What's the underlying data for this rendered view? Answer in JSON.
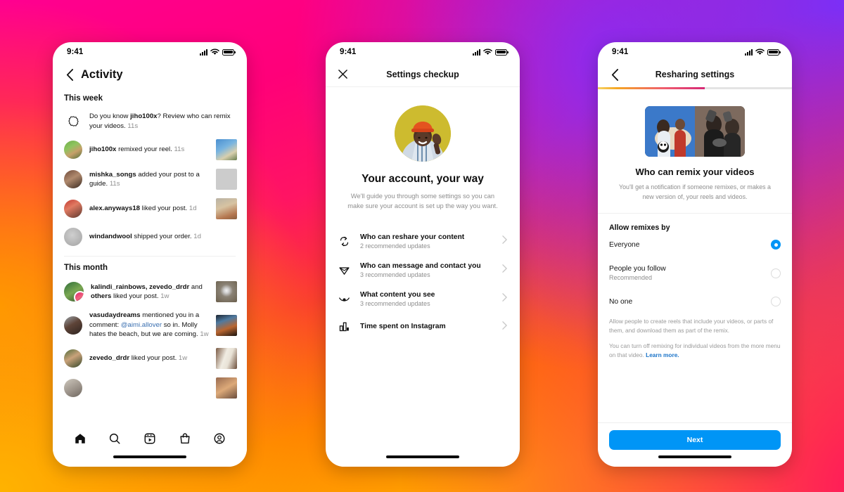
{
  "background": {
    "gradient_colors": [
      "#ff0090",
      "#ff0079",
      "#fb3a2f",
      "#ff7a00",
      "#ffb800",
      "#7b2ff7",
      "#9b27e8",
      "#ff1060"
    ]
  },
  "phone1": {
    "status": {
      "time": "9:41",
      "signal_icon": "cellular-bars-icon",
      "wifi_icon": "wifi-icon",
      "battery_icon": "battery-full-icon"
    },
    "header": {
      "back_icon": "chevron-left-icon",
      "title": "Activity"
    },
    "sections": [
      {
        "label": "This week",
        "items": [
          {
            "type": "prompt",
            "icon": "remix-burst-icon",
            "parts": [
              {
                "t": "Do you know ",
                "style": "normal"
              },
              {
                "t": "jiho100x",
                "style": "bold"
              },
              {
                "t": "? Review who can remix your videos. ",
                "style": "normal"
              },
              {
                "t": "11s",
                "style": "time"
              }
            ],
            "has_thumb": false
          },
          {
            "type": "activity",
            "avatar": "avatar-jiho100x",
            "parts": [
              {
                "t": "jiho100x",
                "style": "bold"
              },
              {
                "t": " remixed your reel. ",
                "style": "normal"
              },
              {
                "t": "11s",
                "style": "time"
              }
            ],
            "has_thumb": true,
            "thumb": "thumb-blue-sky-building"
          },
          {
            "type": "activity",
            "avatar": "avatar-mishka-songs",
            "parts": [
              {
                "t": "mishka_songs",
                "style": "bold"
              },
              {
                "t": " added your post to a guide. ",
                "style": "normal"
              },
              {
                "t": "11s",
                "style": "time"
              }
            ],
            "has_thumb": true,
            "thumb": "thumb-desert-person"
          },
          {
            "type": "activity",
            "avatar": "avatar-alex-anyways18",
            "parts": [
              {
                "t": "alex.anyways18",
                "style": "bold"
              },
              {
                "t": " liked your post. ",
                "style": "normal"
              },
              {
                "t": "1d",
                "style": "time"
              }
            ],
            "has_thumb": true,
            "thumb": "thumb-group-outdoors"
          },
          {
            "type": "activity",
            "avatar": "avatar-windandwool",
            "parts": [
              {
                "t": "windandwool",
                "style": "bold"
              },
              {
                "t": " shipped your order. ",
                "style": "normal"
              },
              {
                "t": "1d",
                "style": "time"
              }
            ],
            "has_thumb": false
          }
        ]
      },
      {
        "label": "This month",
        "items": [
          {
            "type": "activity",
            "avatar": "avatar-kalindi-rainbows-group",
            "parts": [
              {
                "t": "kalindi_rainbows, zevedo_drdr",
                "style": "bold"
              },
              {
                "t": " and ",
                "style": "normal"
              },
              {
                "t": "others",
                "style": "bold"
              },
              {
                "t": " liked your post. ",
                "style": "normal"
              },
              {
                "t": "1w",
                "style": "time"
              }
            ],
            "has_thumb": true,
            "thumb": "thumb-vinyl-record"
          },
          {
            "type": "activity",
            "avatar": "avatar-vasudaydreams",
            "parts": [
              {
                "t": "vasudaydreams",
                "style": "bold"
              },
              {
                "t": " mentioned you in a comment: ",
                "style": "normal"
              },
              {
                "t": "@aimi.allover",
                "style": "mention"
              },
              {
                "t": " so in. Molly hates the beach, but we are coming. ",
                "style": "normal"
              },
              {
                "t": "1w",
                "style": "time"
              }
            ],
            "has_thumb": true,
            "thumb": "thumb-dark-interior"
          },
          {
            "type": "activity",
            "avatar": "avatar-zevedo-drdr",
            "parts": [
              {
                "t": "zevedo_drdr",
                "style": "bold"
              },
              {
                "t": " liked your post. ",
                "style": "normal"
              },
              {
                "t": "1w",
                "style": "time"
              }
            ],
            "has_thumb": true,
            "thumb": "thumb-light-doorway"
          }
        ]
      }
    ],
    "tabbar": [
      {
        "name": "home-icon",
        "label": "Home"
      },
      {
        "name": "search-icon",
        "label": "Search"
      },
      {
        "name": "reels-icon",
        "label": "Reels"
      },
      {
        "name": "shop-icon",
        "label": "Shop"
      },
      {
        "name": "profile-icon",
        "label": "Profile"
      }
    ]
  },
  "phone2": {
    "status": {
      "time": "9:41"
    },
    "header": {
      "close_icon": "close-x-icon",
      "title": "Settings checkup"
    },
    "hero": {
      "image_name": "person-waving-orange-hat-photo"
    },
    "heading": "Your account, your way",
    "subheading": "We'll guide you through some settings so you can make sure your account is set up the way you want.",
    "menu": [
      {
        "icon": "reshare-loop-icon",
        "title": "Who can reshare your content",
        "subtitle": "2 recommended updates",
        "chevron": "chevron-right-icon"
      },
      {
        "icon": "paper-plane-icon",
        "title": "Who can message and contact you",
        "subtitle": "3 recommended updates",
        "chevron": "chevron-right-icon"
      },
      {
        "icon": "eye-icon",
        "title": "What content you see",
        "subtitle": "3 recommended updates",
        "chevron": "chevron-right-icon"
      },
      {
        "icon": "bar-chart-icon",
        "title": "Time spent on Instagram",
        "subtitle": "",
        "chevron": "chevron-right-icon"
      }
    ]
  },
  "phone3": {
    "status": {
      "time": "9:41"
    },
    "header": {
      "back_icon": "chevron-left-icon",
      "title": "Resharing settings"
    },
    "progress": {
      "percent": 55,
      "gradient": [
        "#f6d365",
        "#f5a623",
        "#ef5d6e",
        "#d62976"
      ]
    },
    "hero": {
      "image_name": "two-people-remix-split-photo"
    },
    "heading": "Who can remix your videos",
    "subheading": "You'll get a notification if someone remixes, or makes a new version of, your reels and videos.",
    "group_label": "Allow remixes by",
    "options": [
      {
        "label": "Everyone",
        "note": "",
        "selected": true
      },
      {
        "label": "People you follow",
        "note": "Recommended",
        "selected": false
      },
      {
        "label": "No one",
        "note": "",
        "selected": false
      }
    ],
    "footnotes": [
      {
        "text": "Allow people to create reels that include your videos, or parts of them, and download them as part of the remix.",
        "link": ""
      },
      {
        "text": "You can turn off remixing for individual videos from the more menu on that video. ",
        "link": "Learn more."
      }
    ],
    "primary_button": {
      "label": "Next",
      "color": "#0095f6"
    }
  }
}
